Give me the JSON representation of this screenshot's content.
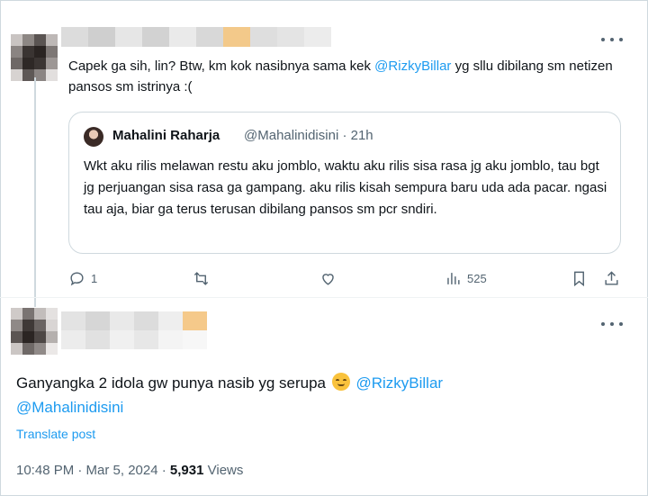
{
  "reply": {
    "text_before": "Capek ga sih, lin? Btw, km kok nasibnya  sama kek ",
    "mention": "@RizkyBillar",
    "text_after": " yg sllu dibilang sm netizen pansos sm istrinya :("
  },
  "quote": {
    "name": "Mahalini Raharja",
    "handle_time": "@Mahalinidisini · 21h",
    "body": "Wkt aku rilis melawan restu aku jomblo, waktu aku rilis sisa rasa jg aku jomblo,  tau bgt jg perjuangan sisa rasa ga gampang. aku rilis kisah sempura baru uda ada pacar. ngasi tau aja, biar ga terus terusan dibilang pansos sm pcr sndiri."
  },
  "actions": {
    "replies": "1",
    "views": "525"
  },
  "main_post": {
    "text": "Ganyangka 2 idola gw punya nasib yg  serupa ",
    "mention1": "@RizkyBillar",
    "mention2": "@Mahalinidisini",
    "translate": "Translate post",
    "time": "10:48 PM · Mar 5, 2024 · ",
    "views_count": "5,931",
    "views_label": " Views"
  },
  "icons": [
    "more-icon",
    "reply-icon",
    "retweet-icon",
    "like-icon",
    "views-icon",
    "bookmark-icon",
    "share-icon"
  ],
  "colors": {
    "link": "#1d9bf0",
    "muted": "#536471",
    "text": "#0f1419",
    "border": "#cfd9de"
  }
}
